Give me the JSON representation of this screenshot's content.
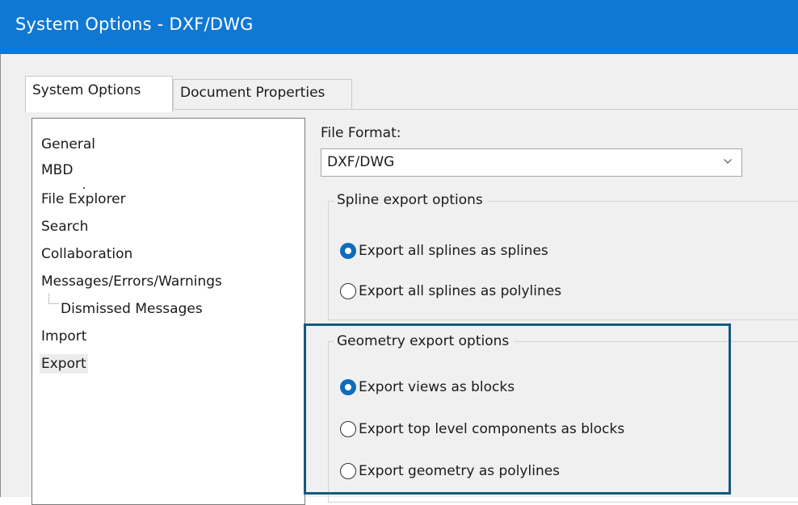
{
  "window": {
    "title": "System Options - DXF/DWG"
  },
  "tabs": [
    {
      "label": "System Options",
      "active": true
    },
    {
      "label": "Document Properties",
      "active": false
    }
  ],
  "nav_tree": {
    "items": [
      {
        "label": "General"
      },
      {
        "label": "MBD"
      },
      {
        "label": "File Explorer"
      },
      {
        "label": "Search"
      },
      {
        "label": "Collaboration"
      },
      {
        "label": "Messages/Errors/Warnings"
      },
      {
        "label": "Dismissed Messages",
        "child": true
      },
      {
        "label": "Import"
      },
      {
        "label": "Export",
        "selected": true
      }
    ]
  },
  "file_format": {
    "label": "File Format:",
    "value": "DXF/DWG"
  },
  "spline_group": {
    "title": "Spline export options",
    "options": [
      {
        "label": "Export all splines as splines",
        "checked": true
      },
      {
        "label": "Export all splines as polylines",
        "checked": false
      }
    ]
  },
  "geometry_group": {
    "title": "Geometry export options",
    "options": [
      {
        "label": "Export views as blocks",
        "checked": true
      },
      {
        "label": "Export top level components as blocks",
        "checked": false
      },
      {
        "label": "Export geometry as polylines",
        "checked": false
      }
    ]
  },
  "colors": {
    "titlebar": "#0f78d4",
    "radio_checked": "#0f6cbd",
    "highlight_border": "#145a7d"
  }
}
